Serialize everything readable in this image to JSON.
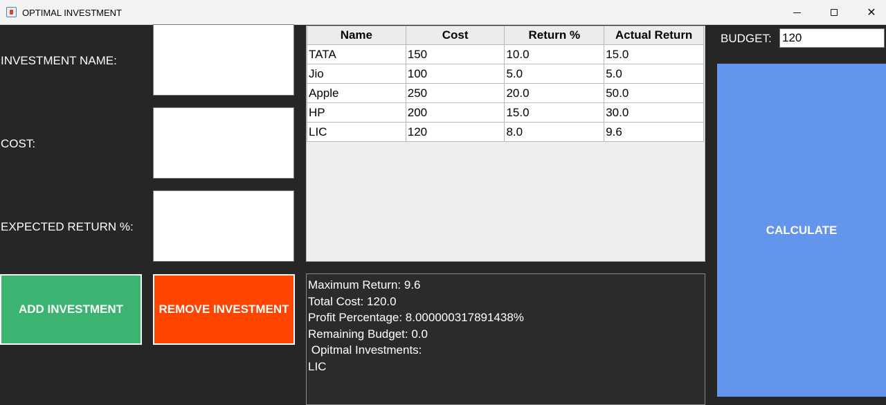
{
  "window": {
    "title": "OPTIMAL INVESTMENT",
    "min_glyph": "—",
    "max_glyph": "☐",
    "close_glyph": "✕"
  },
  "form": {
    "name_label": "INVESTMENT NAME:",
    "cost_label": "COST:",
    "return_label": "EXPECTED RETURN %:",
    "name_value": "",
    "cost_value": "",
    "return_value": "",
    "add_label": "ADD INVESTMENT",
    "remove_label": "REMOVE INVESTMENT"
  },
  "table": {
    "headers": [
      "Name",
      "Cost",
      "Return %",
      "Actual Return"
    ],
    "rows": [
      [
        "TATA",
        "150",
        "10.0",
        "15.0"
      ],
      [
        "Jio",
        "100",
        "5.0",
        "5.0"
      ],
      [
        "Apple",
        "250",
        "20.0",
        "50.0"
      ],
      [
        "HP",
        "200",
        "15.0",
        "30.0"
      ],
      [
        "LIC",
        "120",
        "8.0",
        "9.6"
      ]
    ]
  },
  "output": {
    "lines": [
      "Maximum Return: 9.6",
      "Total Cost: 120.0",
      "Profit Percentage: 8.000000317891438%",
      "Remaining Budget: 0.0",
      "",
      " Opitmal Investments:",
      "LIC"
    ]
  },
  "budget": {
    "label": "BUDGET:",
    "value": "120"
  },
  "calculate_label": "CALCULATE",
  "colors": {
    "add": "#3cb371",
    "remove": "#ff4500",
    "calculate": "#6495ed",
    "background": "#262626"
  }
}
